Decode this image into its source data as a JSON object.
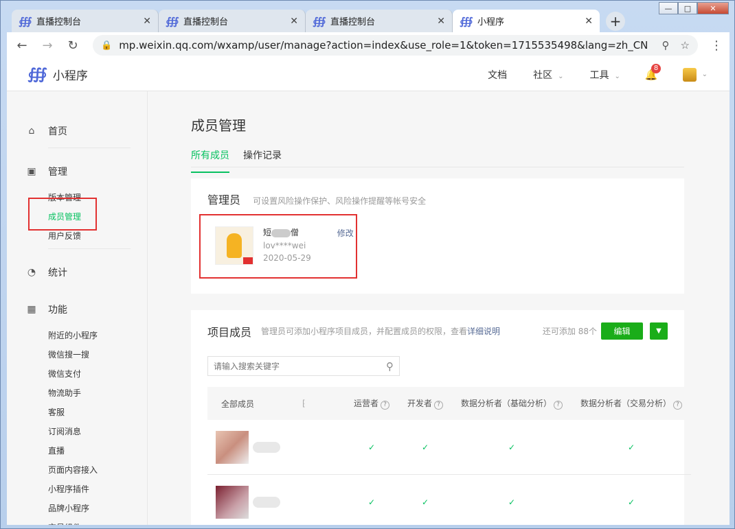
{
  "browser": {
    "tabs": [
      {
        "label": "直播控制台"
      },
      {
        "label": "直播控制台"
      },
      {
        "label": "直播控制台"
      },
      {
        "label": "小程序"
      }
    ],
    "url": "mp.weixin.qq.com/wxamp/user/manage?action=index&use_role=1&token=1715535498&lang=zh_CN"
  },
  "header": {
    "app_name": "小程序",
    "nav": [
      "文档",
      "社区",
      "工具"
    ],
    "notification_count": "8"
  },
  "sidebar": {
    "home": "首页",
    "manage": {
      "label": "管理",
      "items": [
        "版本管理",
        "成员管理",
        "用户反馈"
      ]
    },
    "stats": "统计",
    "features": {
      "label": "功能",
      "items": [
        "附近的小程序",
        "微信搜一搜",
        "微信支付",
        "物流助手",
        "客服",
        "订阅消息",
        "直播",
        "页面内容接入",
        "小程序插件",
        "品牌小程序",
        "交易组件"
      ]
    }
  },
  "main": {
    "title": "成员管理",
    "tabs": [
      "所有成员",
      "操作记录"
    ],
    "admin_card": {
      "title": "管理员",
      "desc": "可设置风险操作保护、风险操作提醒等帐号安全",
      "name_prefix": "短",
      "name_suffix": "僧",
      "account": "lov****wei",
      "date": "2020-05-29",
      "edit_label": "修改"
    },
    "project_card": {
      "title": "项目成员",
      "desc": "管理员可添加小程序项目成员，并配置成员的权限，查看",
      "desc_link": "详细说明",
      "quota": "还可添加 88个",
      "edit_button": "编辑",
      "search_placeholder": "请输入搜索关键字",
      "columns": [
        "全部成员",
        "运营者",
        "开发者",
        "数据分析者（基础分析）",
        "数据分析者（交易分析）"
      ],
      "rows": [
        {
          "marks": [
            "✓",
            "✓",
            "✓",
            "✓"
          ]
        },
        {
          "marks": [
            "✓",
            "✓",
            "✓",
            "✓"
          ]
        }
      ]
    }
  }
}
